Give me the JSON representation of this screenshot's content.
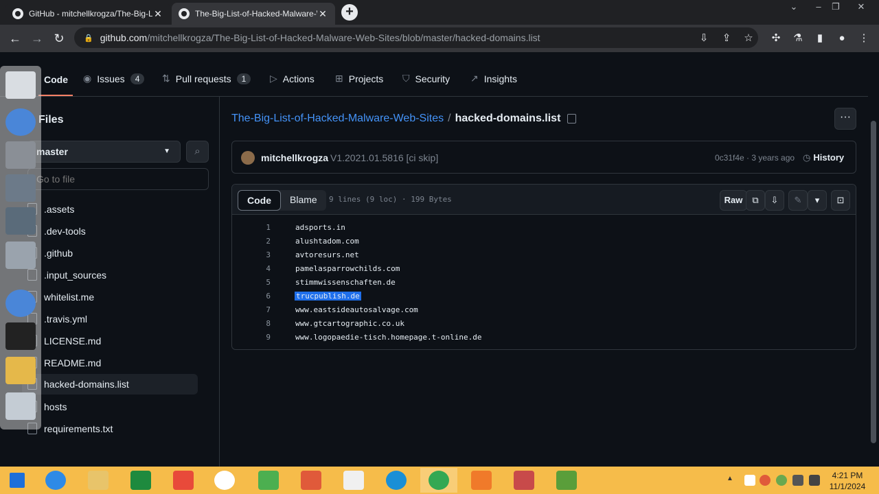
{
  "browser": {
    "tabs": [
      {
        "title": "GitHub - mitchellkrogza/The-Big-List-of-Hacked-Malware-Web-Sites"
      },
      {
        "title": "The-Big-List-of-Hacked-Malware-Web-Sites/hacked-domains.list"
      }
    ],
    "url_host": "github.com",
    "url_path": "/mitchellkrogza/The-Big-List-of-Hacked-Malware-Web-Sites/blob/master/hacked-domains.list"
  },
  "repo_nav": {
    "code": "Code",
    "issues": "Issues",
    "issues_count": "4",
    "pull_requests": "Pull requests",
    "pull_requests_count": "1",
    "actions": "Actions",
    "projects": "Projects",
    "security": "Security",
    "insights": "Insights"
  },
  "file_tree": {
    "title": "Files",
    "branch": "master",
    "goto_placeholder": "Go to file",
    "items": [
      {
        "label": ".assets"
      },
      {
        "label": ".dev-tools"
      },
      {
        "label": ".github"
      },
      {
        "label": ".input_sources"
      },
      {
        "label": "whitelist.me"
      },
      {
        "label": ".travis.yml"
      },
      {
        "label": "LICENSE.md"
      },
      {
        "label": "README.md"
      },
      {
        "label": "hacked-domains.list"
      },
      {
        "label": "hosts"
      },
      {
        "label": "requirements.txt"
      }
    ]
  },
  "breadcrumb": {
    "repo": "The-Big-List-of-Hacked-Malware-Web-Sites",
    "separator": "/",
    "file": "hacked-domains.list"
  },
  "commit": {
    "author": "mitchellkrogza",
    "message": "V1.2021.01.5816 [ci skip]",
    "meta": "0c31f4e · 3 years ago",
    "history": "History"
  },
  "file_view": {
    "tab_code": "Code",
    "tab_blame": "Blame",
    "stats": "9 lines (9 loc) · 199 Bytes",
    "raw": "Raw",
    "lines": [
      {
        "n": "1",
        "text": "adsports.in"
      },
      {
        "n": "2",
        "text": "alushtadom.com"
      },
      {
        "n": "3",
        "text": "avtoresurs.net"
      },
      {
        "n": "4",
        "text": "pamelasparrowchilds.com"
      },
      {
        "n": "5",
        "text": "stimmwissenschaften.de"
      },
      {
        "n": "6",
        "text": "trucpublish.de"
      },
      {
        "n": "7",
        "text": "www.eastsideautosalvage.com"
      },
      {
        "n": "8",
        "text": "www.gtcartographic.co.uk"
      },
      {
        "n": "9",
        "text": "www.logopaedie-tisch.homepage.t-online.de"
      }
    ]
  },
  "taskbar": {
    "time": "4:21 PM",
    "date": "11/1/2024"
  },
  "colors": {
    "accent_link": "#4493f8",
    "underline": "#f78166",
    "selection": "#1f6feb",
    "taskbar": "#f6bc4a"
  }
}
